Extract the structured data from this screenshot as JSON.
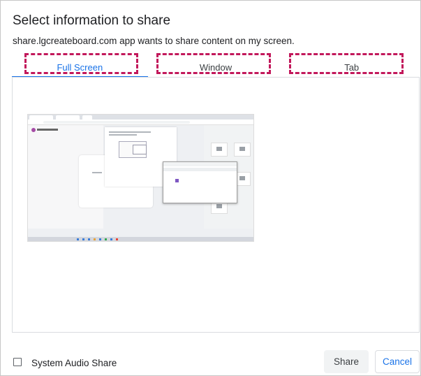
{
  "dialog": {
    "title": "Select information to share",
    "subtitle": "share.lgcreateboard.com app wants to share content on my screen."
  },
  "tabs": [
    {
      "label": "Full Screen",
      "active": true
    },
    {
      "label": "Window",
      "active": false
    },
    {
      "label": "Tab",
      "active": false
    }
  ],
  "preview": {
    "selected": true
  },
  "footer": {
    "audio_checkbox_label": "System Audio Share",
    "audio_checked": false,
    "share_label": "Share",
    "cancel_label": "Cancel"
  },
  "colors": {
    "accent": "#1a73e8",
    "highlight": "#c2185b"
  }
}
